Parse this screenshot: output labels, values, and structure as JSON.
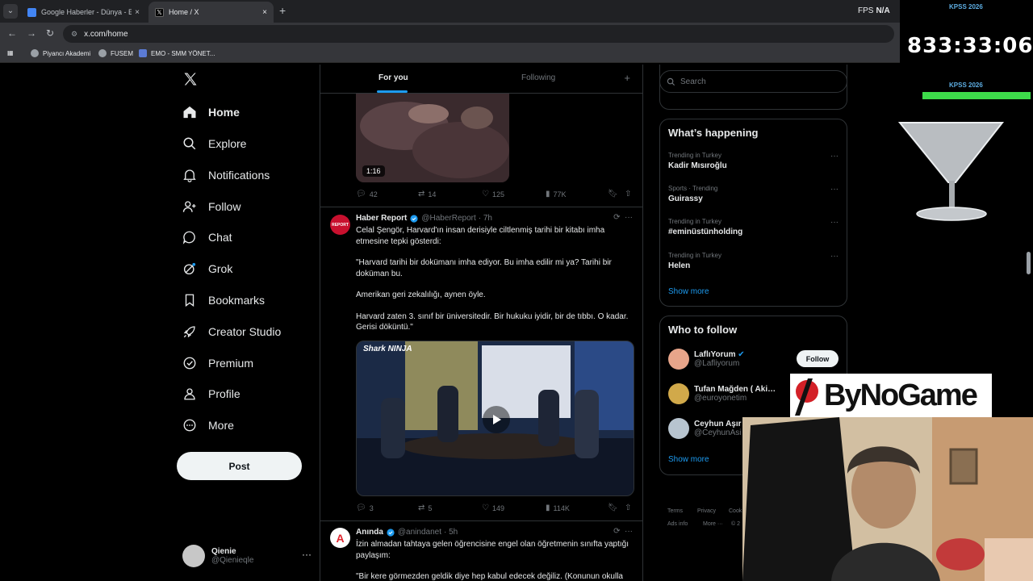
{
  "browser": {
    "tabs": [
      {
        "title": "Google Haberler - Dünya - En y",
        "close": "×"
      },
      {
        "title": "Home / X",
        "close": "×"
      }
    ],
    "new_tab": "+",
    "fps_label": "FPS",
    "fps_value": "N/A",
    "url": "x.com/home",
    "bookmarks": [
      "Piyancı Akademi",
      "FUSEM",
      "EMO - SMM YÖNET..."
    ]
  },
  "nav": {
    "items": [
      {
        "label": "Home",
        "icon": "home-icon"
      },
      {
        "label": "Explore",
        "icon": "search-icon"
      },
      {
        "label": "Notifications",
        "icon": "bell-icon"
      },
      {
        "label": "Follow",
        "icon": "add-user-icon"
      },
      {
        "label": "Chat",
        "icon": "chat-icon"
      },
      {
        "label": "Grok",
        "icon": "grok-icon"
      },
      {
        "label": "Bookmarks",
        "icon": "bookmark-icon"
      },
      {
        "label": "Creator Studio",
        "icon": "rocket-icon"
      },
      {
        "label": "Premium",
        "icon": "verified-icon"
      },
      {
        "label": "Profile",
        "icon": "person-icon"
      },
      {
        "label": "More",
        "icon": "more-circle-icon"
      }
    ],
    "post_label": "Post",
    "account": {
      "name": "Qienie",
      "handle": "@Qienieqle"
    }
  },
  "timeline": {
    "tabs": [
      "For you",
      "Following"
    ],
    "add": "+",
    "tweet0": {
      "duration": "1:16",
      "replies": "42",
      "reposts": "14",
      "likes": "125",
      "views": "77K"
    },
    "tweet1": {
      "name": "Haber Report",
      "handle": "@HaberReport",
      "time": "· 7h",
      "avatar_text": "REPORT",
      "text": [
        "Celal Şengör, Harvard'ın insan derisiyle ciltlenmiş tarihi bir kitabı imha etmesine tepki gösterdi:",
        "\"Harvard tarihi bir dokümanı imha ediyor. Bu imha edilir mi ya? Tarihi bir doküman bu.",
        "Amerikan geri zekalılığı, aynen öyle.",
        "Harvard zaten 3. sınıf bir üniversitedir. Bir hukuku iyidir, bir de tıbbı. O kadar. Gerisi döküntü.\""
      ],
      "video_logo": "Shark NINJA",
      "replies": "3",
      "reposts": "5",
      "likes": "149",
      "views": "114K"
    },
    "tweet2": {
      "name": "Anında",
      "handle": "@anindanet",
      "time": "· 5h",
      "avatar_text": "A",
      "text": [
        "İzin almadan tahtaya gelen öğrencisine engel olan öğretmenin sınıfta yaptığı paylaşım:",
        "\"Bir kere görmezden geldik diye hep kabul edecek değiliz. (Konunun okulla"
      ]
    }
  },
  "sidebar": {
    "search_placeholder": "Search",
    "happening_title": "What’s happening",
    "trends": [
      {
        "context": "Trending in Turkey",
        "name": "Kadir Mısıroğlu"
      },
      {
        "context": "Sports · Trending",
        "name": "Guirassy"
      },
      {
        "context": "Trending in Turkey",
        "name": "#eminüstünholding"
      },
      {
        "context": "Trending in Turkey",
        "name": "Helen"
      }
    ],
    "show_more": "Show more",
    "wtf_title": "Who to follow",
    "wtf": [
      {
        "name": "LaflıYorum",
        "handle": "@Lafliyorum"
      },
      {
        "name": "Tufan Mağden ( Aki…",
        "handle": "@euroyonetim"
      },
      {
        "name": "Ceyhun Aşır",
        "handle": "@CeyhunAsi"
      }
    ],
    "follow_label": "Follow",
    "footer": [
      "Terms",
      "Privacy",
      "Cook",
      "Ads info",
      "More ···",
      "© 2"
    ]
  },
  "overlays": {
    "kpss_top": "KPSS 2026",
    "kpss_bottom": "KPSS 2026",
    "timer": "833:33:06",
    "brand": "ByNoGame"
  },
  "colors": {
    "accent": "#1d9bf0",
    "bg": "#000000",
    "border": "#2f3336",
    "muted": "#71767b"
  }
}
